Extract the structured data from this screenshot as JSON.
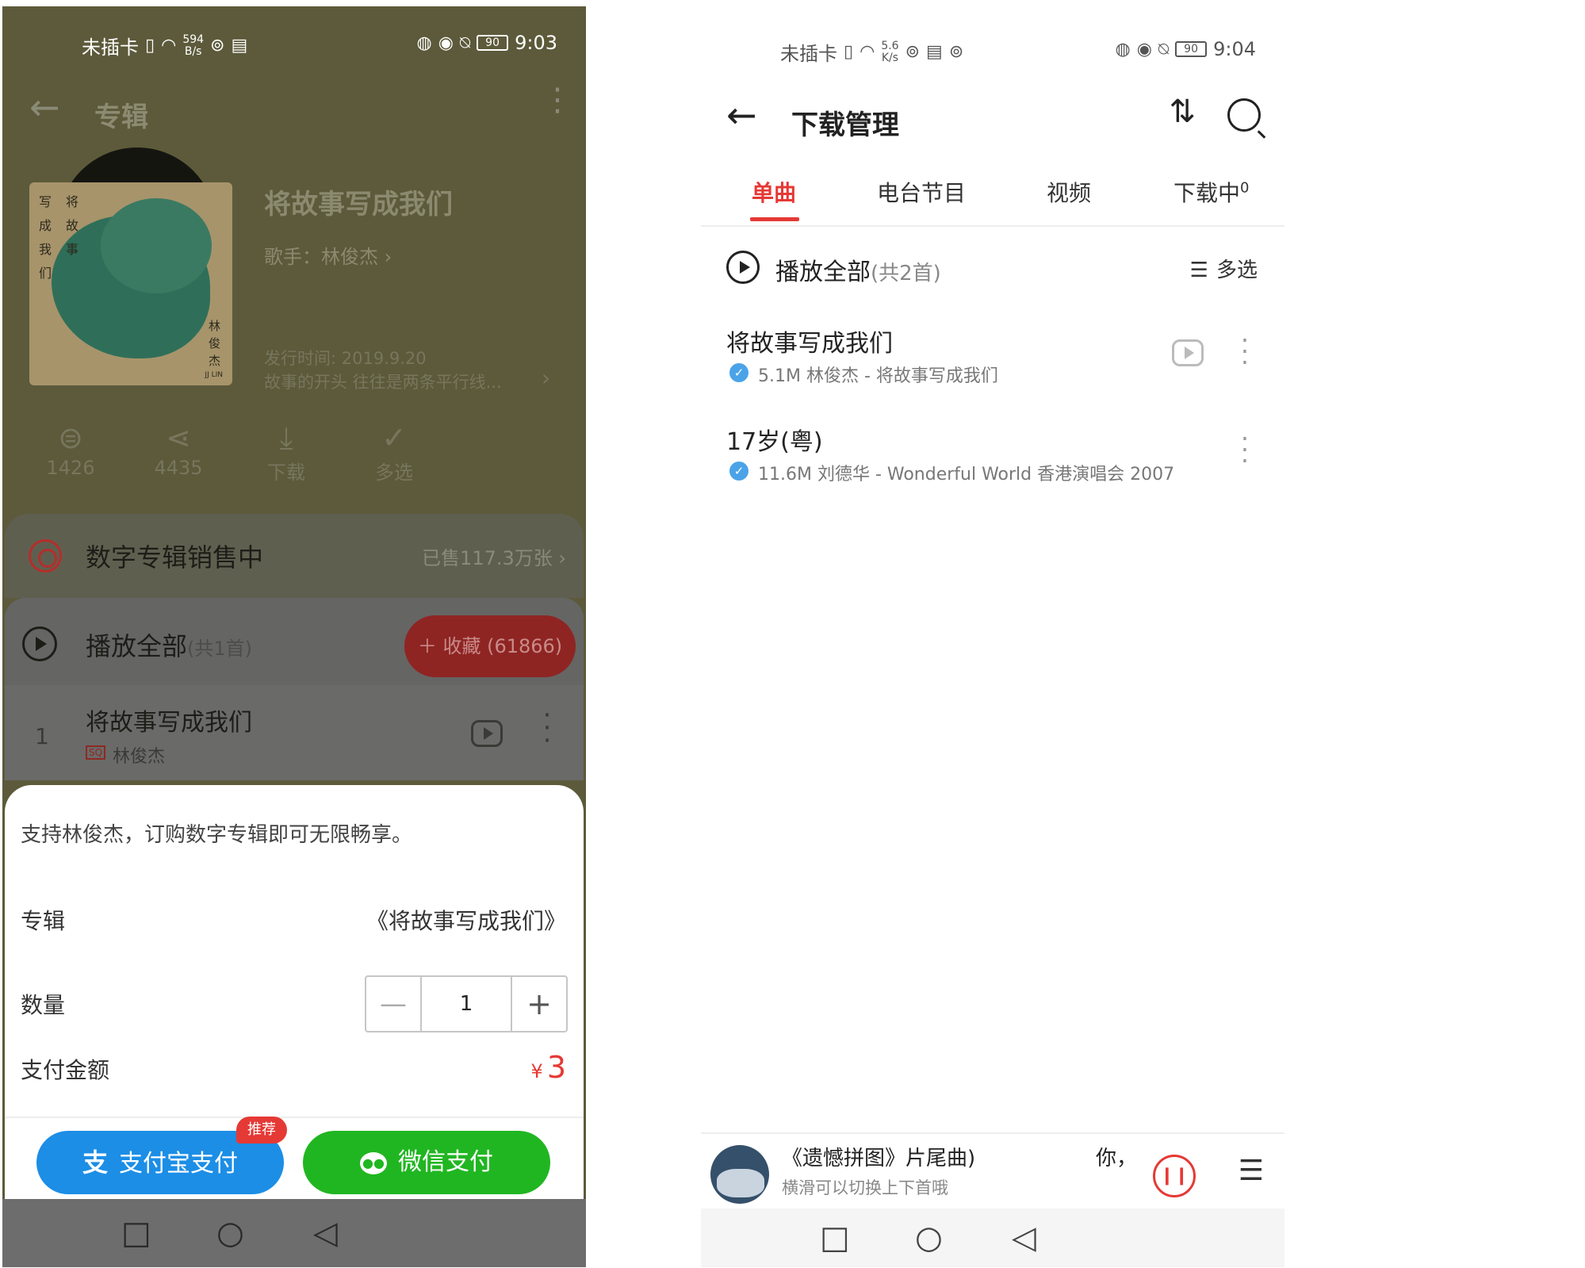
{
  "left": {
    "status_bar": {
      "carrier": "未插卡",
      "speed_value": "594",
      "speed_unit": "B/s",
      "battery": "90",
      "time": "9:03"
    },
    "appbar": {
      "title": "专辑"
    },
    "album": {
      "title": "将故事写成我们",
      "artist": "歌手：林俊杰",
      "release_date": "发行时间: 2019.9.20",
      "description": "故事的开头 往往是两条平行线...",
      "cover_text": {
        "col1": "写成我们",
        "col2": "将故事",
        "col3": "林俊杰",
        "signature": "JJ LIN"
      }
    },
    "actions": [
      {
        "icon": "comment-icon",
        "label": "1426"
      },
      {
        "icon": "share-icon",
        "label": "4435"
      },
      {
        "icon": "download-icon",
        "label": "下载"
      },
      {
        "icon": "multiselect-icon",
        "label": "多选"
      }
    ],
    "digital_sale": {
      "label": "数字专辑销售中",
      "sold": "已售117.3万张"
    },
    "play_all": {
      "label": "播放全部",
      "count": "(共1首)",
      "collect_button": "收藏 (61866)"
    },
    "track": {
      "number": "1",
      "name": "将故事写成我们",
      "quality_badge": "SQ",
      "artist": "林俊杰"
    },
    "purchase": {
      "intro": "支持林俊杰，订购数字专辑即可无限畅享。",
      "album_label": "专辑",
      "album_value": "《将故事写成我们》",
      "quantity_label": "数量",
      "quantity_value": "1",
      "amount_label": "支付金额",
      "currency": "¥",
      "amount": "3",
      "alipay_button": "支付宝支付",
      "alipay_logo": "支",
      "recommend_badge": "推荐",
      "wechat_button": "微信支付"
    }
  },
  "right": {
    "status_bar": {
      "carrier": "未插卡",
      "speed_value": "5.6",
      "speed_unit": "K/s",
      "battery": "90",
      "time": "9:04"
    },
    "appbar": {
      "title": "下载管理"
    },
    "tabs": [
      {
        "label": "单曲",
        "active": true
      },
      {
        "label": "电台节目",
        "active": false
      },
      {
        "label": "视频",
        "active": false
      },
      {
        "label": "下载中",
        "badge": "0",
        "active": false
      }
    ],
    "play_all": {
      "label": "播放全部",
      "count": "(共2首)",
      "multiselect": "多选"
    },
    "songs": [
      {
        "name": "将故事写成我们",
        "meta": "5.1M 林俊杰 - 将故事写成我们",
        "has_mv": true
      },
      {
        "name": "17岁(粤)",
        "meta": "11.6M 刘德华 - Wonderful World 香港演唱会 2007",
        "has_mv": false
      }
    ],
    "mini_player": {
      "title": "《遗憾拼图》片尾曲)",
      "hint": "横滑可以切换上下首哦",
      "lyric": "你，"
    }
  },
  "colors": {
    "accent_red": "#e53935",
    "alipay_blue": "#1c8ee6",
    "wechat_green": "#20b621",
    "check_blue": "#4aa3e8"
  }
}
